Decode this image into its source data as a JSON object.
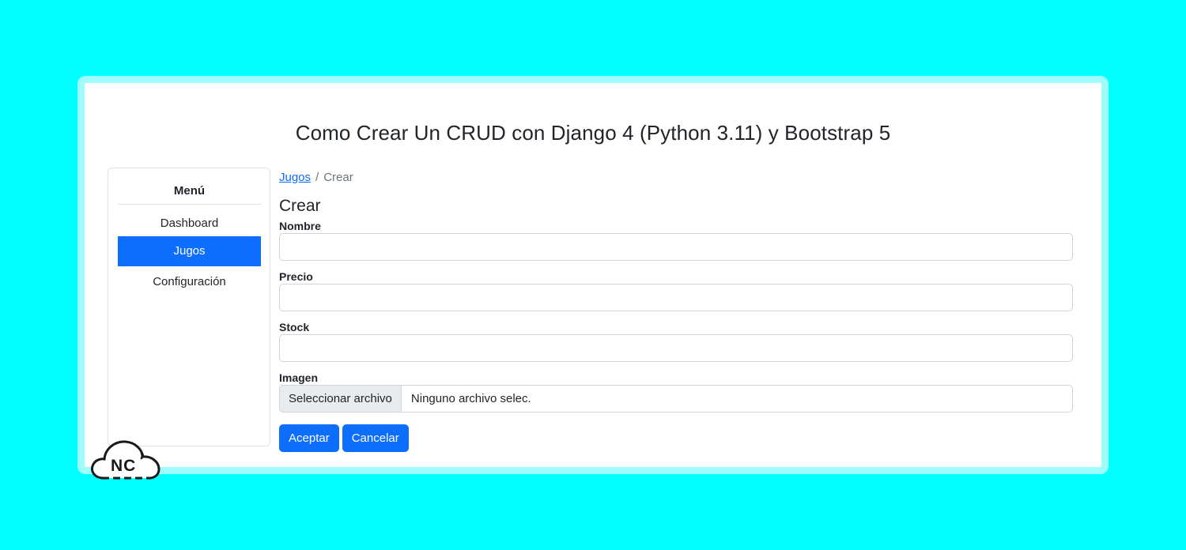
{
  "app": {
    "title": "Como Crear Un CRUD con Django 4 (Python 3.11) y Bootstrap 5"
  },
  "sidebar": {
    "title": "Menú",
    "items": [
      {
        "label": "Dashboard",
        "active": false
      },
      {
        "label": "Jugos",
        "active": true
      },
      {
        "label": "Configuración",
        "active": false
      }
    ]
  },
  "breadcrumb": {
    "link": "Jugos",
    "separator": "/",
    "current": "Crear"
  },
  "form": {
    "heading": "Crear",
    "fields": [
      {
        "label": "Nombre",
        "value": ""
      },
      {
        "label": "Precio",
        "value": ""
      },
      {
        "label": "Stock",
        "value": ""
      }
    ],
    "image": {
      "label": "Imagen",
      "button": "Seleccionar archivo",
      "status": "Ninguno archivo selec."
    },
    "buttons": {
      "accept": "Aceptar",
      "cancel": "Cancelar"
    }
  },
  "logo": {
    "text": "NC",
    "icon": "cloud-icon"
  },
  "colors": {
    "background": "#00ffff",
    "primary": "#0d6efd"
  }
}
